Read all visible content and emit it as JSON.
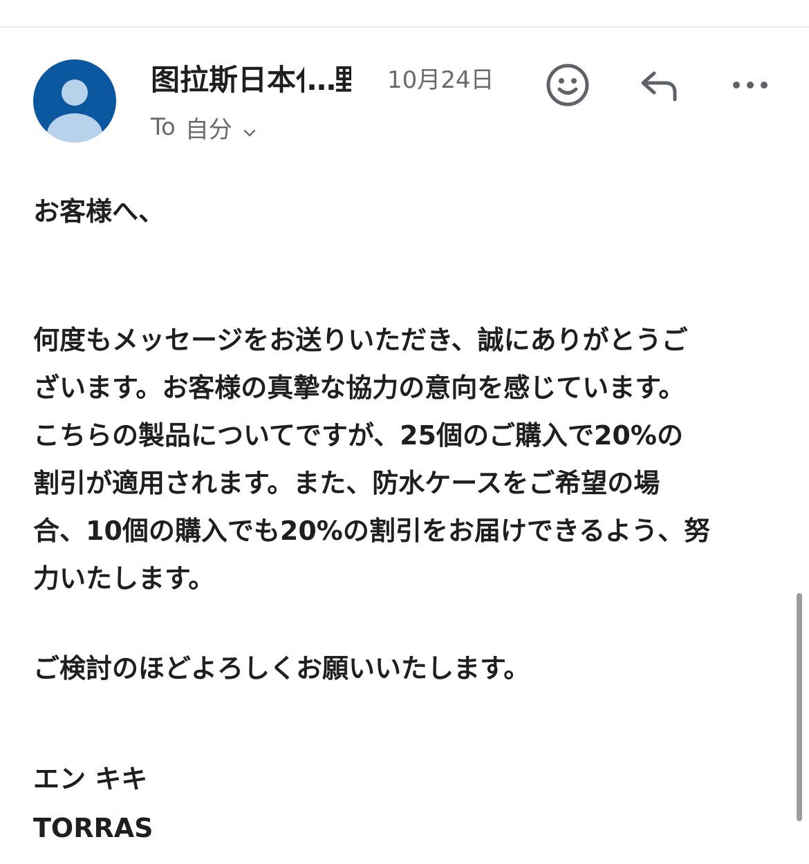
{
  "header": {
    "sender_name": "图拉斯日本代理店",
    "ellipsis": "…",
    "date": "10月24日",
    "recipient_prefix": "To",
    "recipient": "自分"
  },
  "icons": {
    "avatar": "person-avatar-icon",
    "emoji": "smiley-icon",
    "reply": "reply-icon",
    "more": "more-horizontal-icon",
    "expand": "chevron-down-icon"
  },
  "colors": {
    "avatar_bg": "#0b57a0",
    "avatar_figure": "#b7d2ea",
    "secondary_text": "#6a6a6a",
    "primary_text": "#1f1f1f"
  },
  "body": {
    "greeting": "お客様へ、",
    "lines": [
      "何度もメッセージをお送りいただき、誠にありがとうご",
      "ざいます。お客様の真摯な協力の意向を感じています。",
      "こちらの製品についてですが、25個のご購入で20%の",
      "割引が適用されます。また、防水ケースをご希望の場",
      "合、10個の購入でも20%の割引をお届けできるよう、努",
      "力いたします。"
    ],
    "closing": "ご検討のほどよろしくお願いいたします。",
    "signature_name": "エン キキ",
    "signature_company": "TORRAS"
  }
}
